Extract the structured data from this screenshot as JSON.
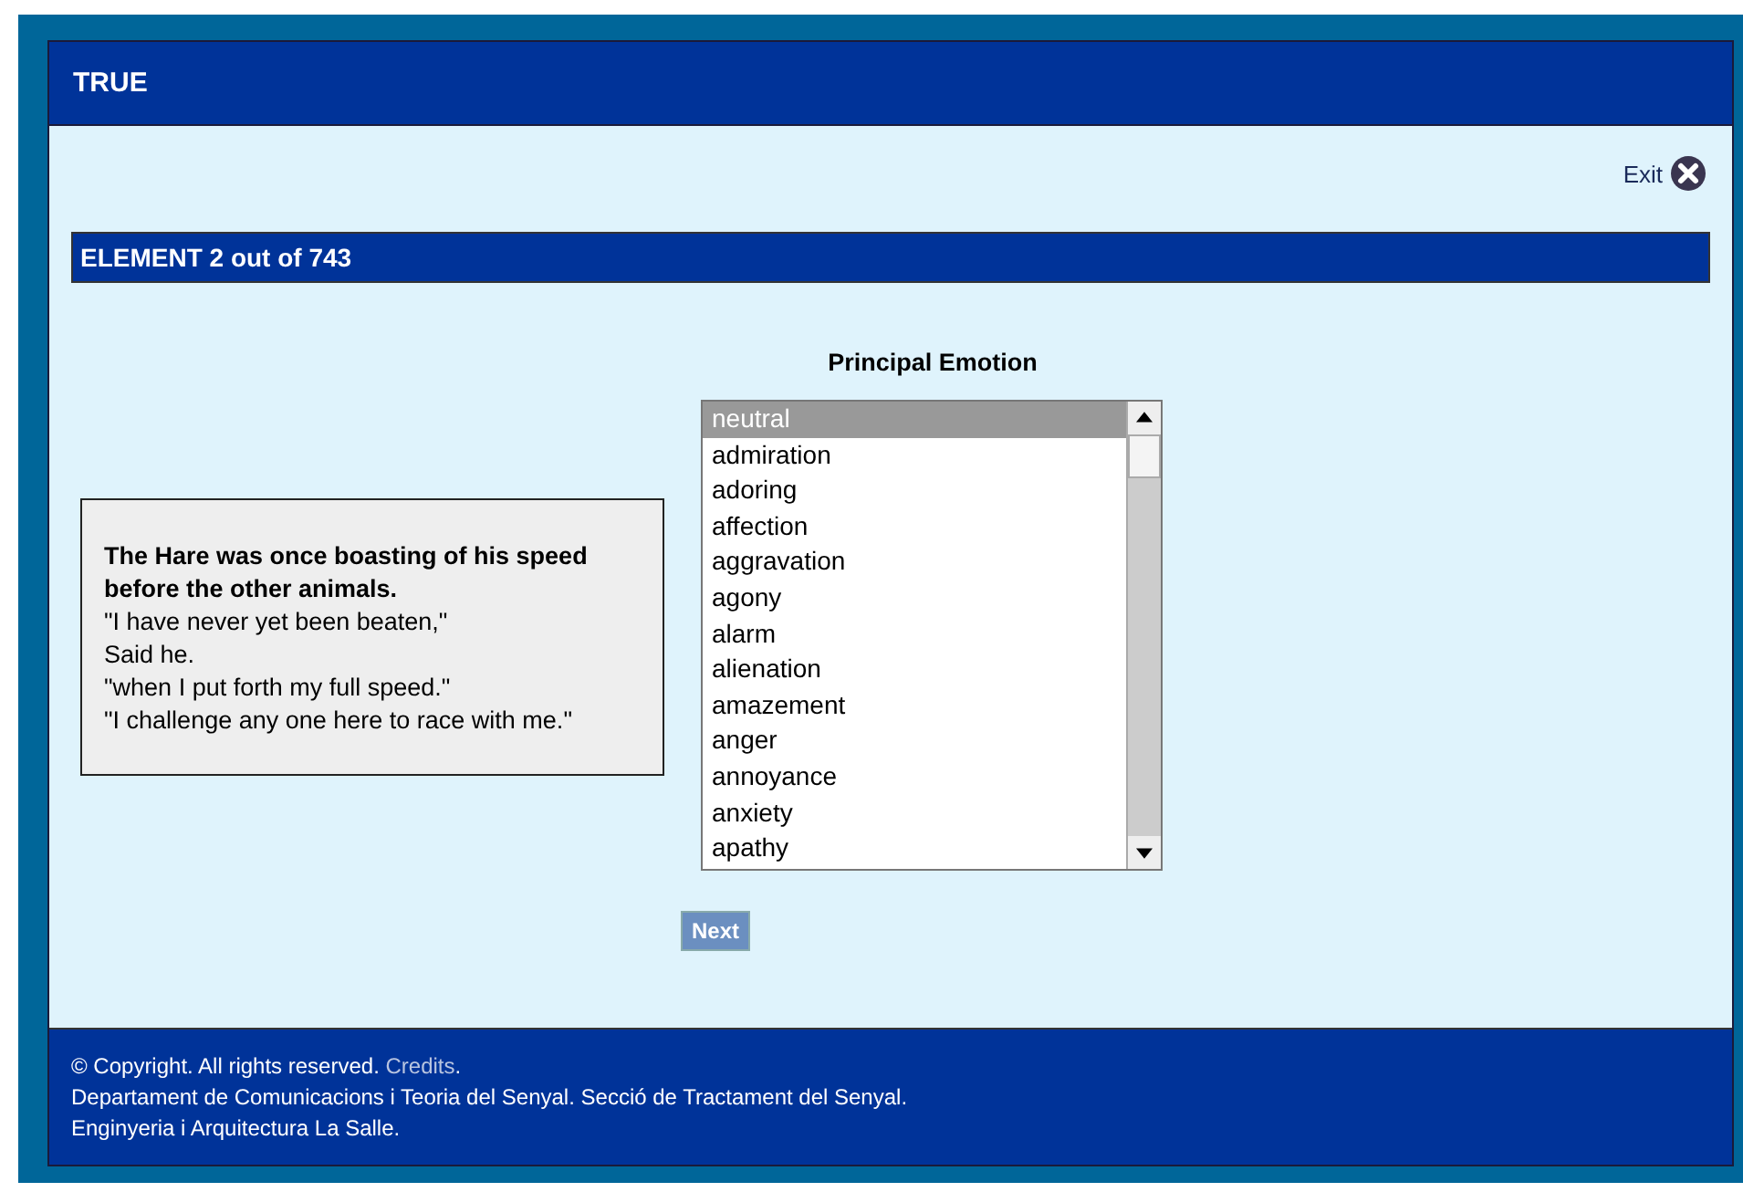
{
  "header": {
    "title": "TRUE"
  },
  "exit": {
    "label": "Exit"
  },
  "progress": {
    "label": "ELEMENT 2 out of 743"
  },
  "story": {
    "heading": "The Hare was once boasting of his speed before the other animals.",
    "lines": [
      "\"I have never yet been beaten,\"",
      "Said he.",
      "\"when I put forth my full speed.\"",
      "\"I challenge any one here to race with me.\""
    ]
  },
  "emotion_list": {
    "label": "Principal Emotion",
    "options": [
      {
        "label": "neutral",
        "selected": true
      },
      {
        "label": "admiration",
        "selected": false
      },
      {
        "label": "adoring",
        "selected": false
      },
      {
        "label": "affection",
        "selected": false
      },
      {
        "label": "aggravation",
        "selected": false
      },
      {
        "label": "agony",
        "selected": false
      },
      {
        "label": "alarm",
        "selected": false
      },
      {
        "label": "alienation",
        "selected": false
      },
      {
        "label": "amazement",
        "selected": false
      },
      {
        "label": "anger",
        "selected": false
      },
      {
        "label": "annoyance",
        "selected": false
      },
      {
        "label": "anxiety",
        "selected": false
      },
      {
        "label": "apathy",
        "selected": false
      }
    ]
  },
  "next_button": {
    "label": "Next"
  },
  "footer": {
    "copyright": "© Copyright. All rights reserved.",
    "credits_link": "Credits",
    "copyright_end": ".",
    "lines": [
      "Departament de Comunicacions i Teoria del Senyal. Secció de Tractament del Senyal.",
      "Enginyeria i Arquitectura La Salle."
    ]
  }
}
